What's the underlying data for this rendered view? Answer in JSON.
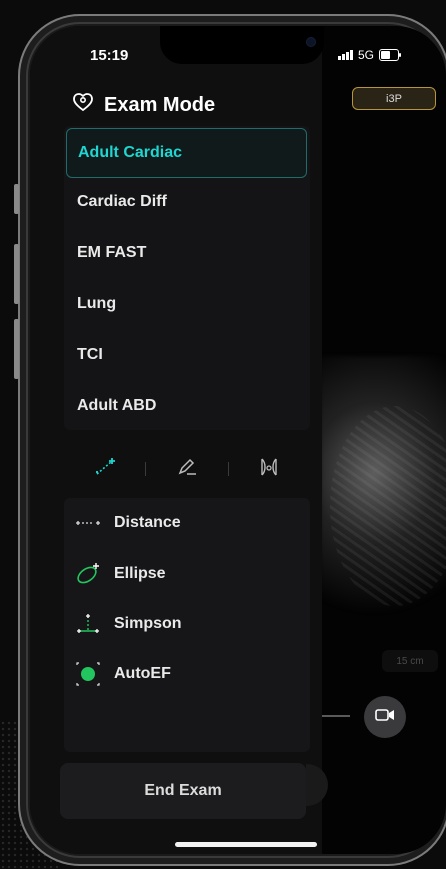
{
  "status_bar": {
    "time": "15:19",
    "network": "5G"
  },
  "probe": {
    "label": "i3P"
  },
  "exam_mode": {
    "title": "Exam Mode",
    "items": [
      {
        "label": "Adult Cardiac",
        "active": true
      },
      {
        "label": "Cardiac Diff",
        "active": false
      },
      {
        "label": "EM FAST",
        "active": false
      },
      {
        "label": "Lung",
        "active": false
      },
      {
        "label": "TCI",
        "active": false
      },
      {
        "label": "Adult ABD",
        "active": false
      }
    ]
  },
  "tool_tabs": [
    {
      "icon": "measure-calipers-icon",
      "active": true
    },
    {
      "icon": "annotate-pen-icon",
      "active": false
    },
    {
      "icon": "body-marker-icon",
      "active": false
    }
  ],
  "measurements": [
    {
      "label": "Distance",
      "icon": "distance-icon"
    },
    {
      "label": "Ellipse",
      "icon": "ellipse-icon"
    },
    {
      "label": "Simpson",
      "icon": "simpson-icon"
    },
    {
      "label": "AutoEF",
      "icon": "autoef-icon"
    }
  ],
  "end_exam_label": "End Exam",
  "depth": "15 cm",
  "colors": {
    "accent": "#1fd6d0",
    "probe_border": "#b8953a",
    "autoef_green": "#22c55e"
  }
}
